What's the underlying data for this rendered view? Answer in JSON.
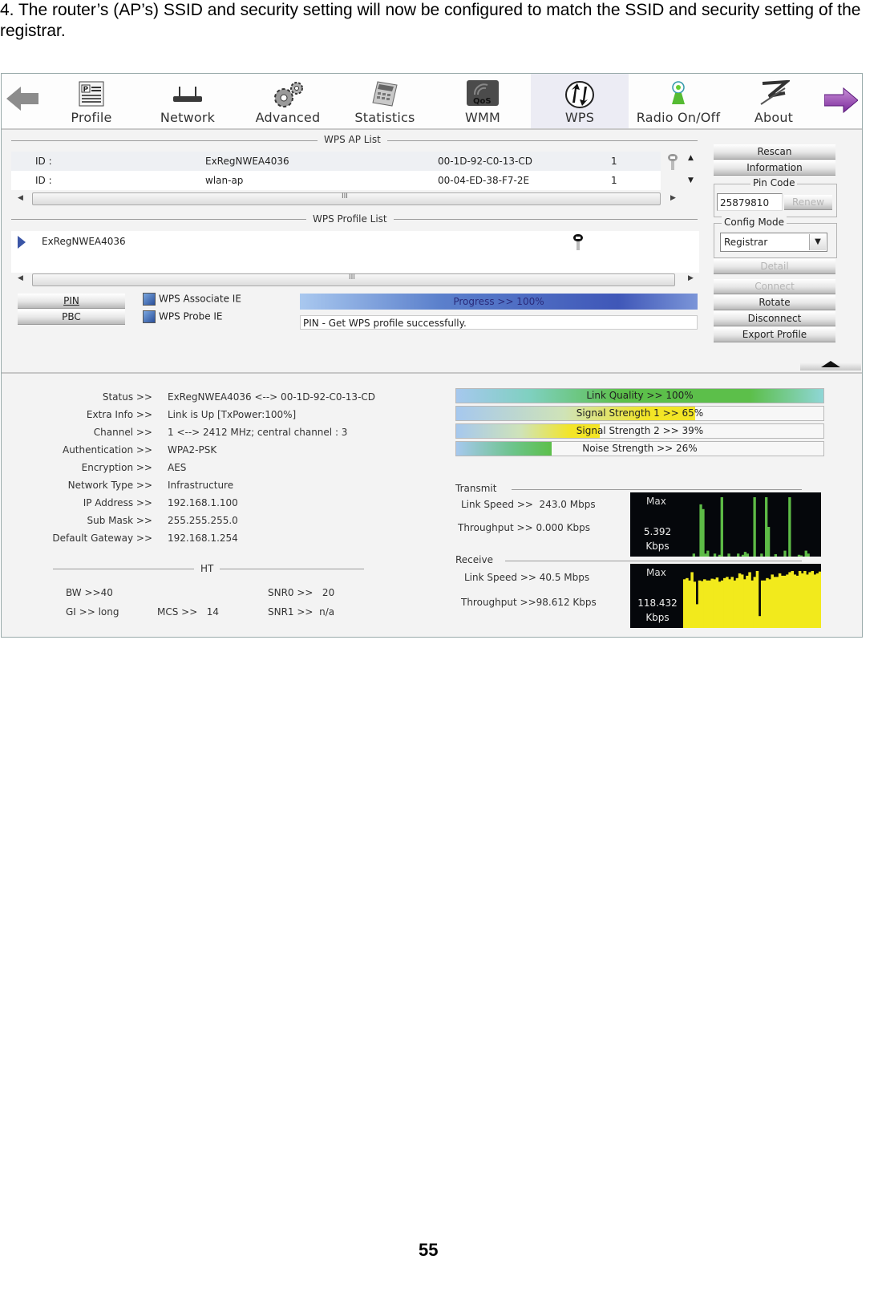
{
  "caption": "4. The router’s (AP’s) SSID and security setting will now be configured to match the SSID and security setting of the registrar.",
  "page_number": "55",
  "toolbar": {
    "back_icon": "back-arrow-icon",
    "forward_icon": "forward-arrow-icon",
    "items": [
      {
        "label": "Profile",
        "icon": "profile-icon"
      },
      {
        "label": "Network",
        "icon": "network-router-icon"
      },
      {
        "label": "Advanced",
        "icon": "gears-icon"
      },
      {
        "label": "Statistics",
        "icon": "calculator-icon"
      },
      {
        "label": "WMM",
        "icon": "qos-icon"
      },
      {
        "label": "WPS",
        "icon": "wps-icon",
        "active": true
      },
      {
        "label": "Radio On/Off",
        "icon": "radio-icon"
      },
      {
        "label": "About",
        "icon": "about-icon"
      }
    ]
  },
  "wps_ap_list": {
    "title": "WPS AP List",
    "rows": [
      {
        "id_label": "ID :",
        "ssid": "ExRegNWEA4036",
        "bssid": "00-1D-92-C0-13-CD",
        "channel": "1"
      },
      {
        "id_label": "ID :",
        "ssid": "wlan-ap",
        "bssid": "00-04-ED-38-F7-2E",
        "channel": "1"
      }
    ]
  },
  "wps_profile_list": {
    "title": "WPS Profile List",
    "profiles": [
      {
        "name": "ExRegNWEA4036"
      }
    ]
  },
  "scroll_grip": "III",
  "controls": {
    "pin_label": "PIN",
    "pbc_label": "PBC",
    "associate_ie_label": "WPS Associate IE",
    "associate_ie_checked": true,
    "probe_ie_label": "WPS Probe IE",
    "probe_ie_checked": true,
    "progress_text": "Progress >> 100%",
    "progress_value": 100,
    "status_message": "PIN - Get WPS profile successfully."
  },
  "side_buttons": {
    "rescan": "Rescan",
    "information": "Information",
    "pin_code_title": "Pin Code",
    "pin_code_value": "25879810",
    "renew": "Renew",
    "config_mode_title": "Config Mode",
    "config_mode_value": "Registrar",
    "detail": "Detail",
    "connect": "Connect",
    "rotate": "Rotate",
    "disconnect": "Disconnect",
    "export_profile": "Export Profile"
  },
  "status_info": [
    {
      "label": "Status >>",
      "value": "ExRegNWEA4036 <--> 00-1D-92-C0-13-CD"
    },
    {
      "label": "Extra Info >>",
      "value": "Link is Up [TxPower:100%]"
    },
    {
      "label": "Channel >>",
      "value": "1 <--> 2412 MHz; central channel : 3"
    },
    {
      "label": "Authentication >>",
      "value": "WPA2-PSK"
    },
    {
      "label": "Encryption >>",
      "value": "AES"
    },
    {
      "label": "Network Type >>",
      "value": "Infrastructure"
    },
    {
      "label": "IP Address >>",
      "value": "192.168.1.100"
    },
    {
      "label": "Sub Mask >>",
      "value": "255.255.255.0"
    },
    {
      "label": "Default Gateway >>",
      "value": "192.168.1.254"
    }
  ],
  "ht": {
    "title": "HT",
    "bw": "BW >>40",
    "gi": "GI >> long",
    "mcs": "MCS >>   14",
    "snr0": "SNR0 >>   20",
    "snr1": "SNR1 >>  n/a"
  },
  "signal_bars": [
    {
      "text": "Link Quality >> 100%",
      "percent": 100,
      "kind": "link"
    },
    {
      "text": "Signal Strength 1 >> 65%",
      "percent": 65,
      "kind": "signal"
    },
    {
      "text": "Signal Strength 2 >> 39%",
      "percent": 39,
      "kind": "signal"
    },
    {
      "text": "Noise Strength >> 26%",
      "percent": 26,
      "kind": "noise"
    }
  ],
  "colors": {
    "tx_graph": "#5dbb46",
    "rx_graph": "#f2ea1c",
    "link_quality": "#5cbf4a",
    "signal": "#f3e526",
    "progress": "#3f57b8"
  },
  "transmit": {
    "title": "Transmit",
    "link_speed": "Link Speed >>  243.0 Mbps",
    "throughput": "Throughput >> 0.000 Kbps",
    "graph_max_label": "Max",
    "graph_value": "5.392",
    "graph_unit": "Kbps",
    "graph_samples": [
      0,
      0,
      0,
      0,
      0.05,
      0,
      0,
      0.88,
      0.8,
      0.05,
      0.1,
      0,
      0,
      0.05,
      0,
      0.03,
      1,
      0,
      0,
      0.05,
      0,
      0,
      0,
      0.05,
      0,
      0.03,
      0.08,
      0.05,
      0,
      0,
      1,
      0,
      0,
      0.05,
      0,
      1,
      0.5,
      0,
      0,
      0.04,
      0,
      0,
      0,
      0.1,
      0,
      1,
      0,
      0,
      0,
      0.03,
      0.02,
      0,
      0.1,
      0.05,
      0,
      0,
      0,
      0,
      0
    ]
  },
  "receive": {
    "title": "Receive",
    "link_speed": "Link Speed >> 40.5 Mbps",
    "throughput": "Throughput >>98.612 Kbps",
    "graph_max_label": "Max",
    "graph_value": "118.432",
    "graph_unit": "Kbps",
    "graph_samples": [
      0.82,
      0.84,
      0.8,
      0.94,
      0.78,
      0.4,
      0.8,
      0.79,
      0.82,
      0.8,
      0.8,
      0.83,
      0.82,
      0.85,
      0.78,
      0.8,
      0.84,
      0.86,
      0.82,
      0.86,
      0.8,
      0.84,
      0.92,
      0.9,
      0.82,
      0.88,
      0.94,
      0.8,
      0.86,
      0.96,
      0.2,
      0.8,
      0.8,
      0.84,
      0.82,
      0.9,
      0.86,
      0.86,
      0.92,
      0.88,
      0.88,
      0.9,
      0.94,
      0.96,
      0.9,
      0.88,
      0.96,
      0.92,
      0.96,
      0.9,
      0.94,
      0.96,
      0.9,
      0.92,
      0.95
    ]
  }
}
